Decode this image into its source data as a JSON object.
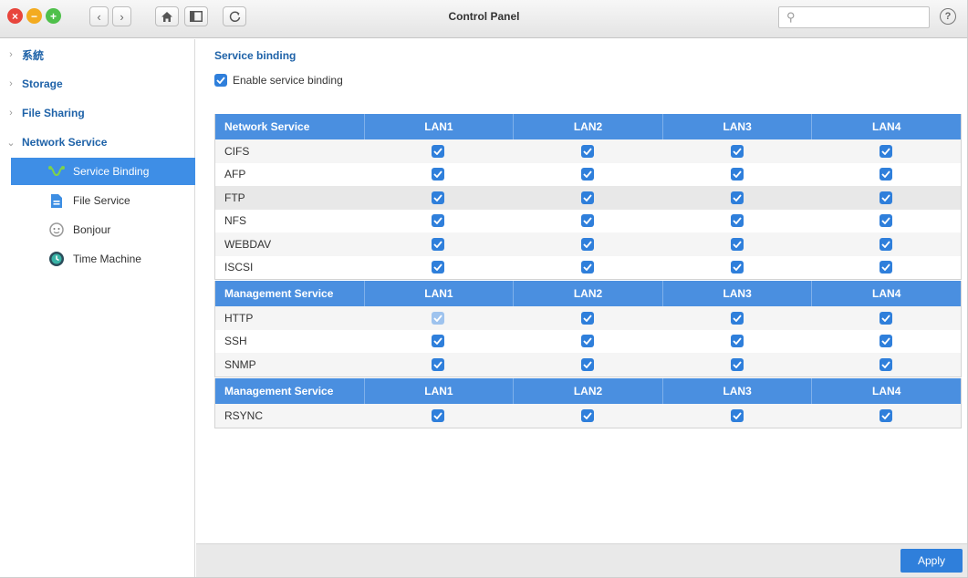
{
  "window": {
    "title": "Control Panel"
  },
  "titlebar": {
    "close_icon": "close-icon",
    "minimize_icon": "minimize-icon",
    "zoom_icon": "zoom-icon",
    "search_placeholder": "",
    "help_label": "?"
  },
  "sidebar": {
    "items": [
      {
        "label": "系統",
        "expanded": false
      },
      {
        "label": "Storage",
        "expanded": false
      },
      {
        "label": "File Sharing",
        "expanded": false
      },
      {
        "label": "Network Service",
        "expanded": true
      }
    ],
    "subitems": [
      {
        "label": "Service Binding",
        "icon": "service-binding-icon",
        "active": true
      },
      {
        "label": "File Service",
        "icon": "file-service-icon",
        "active": false
      },
      {
        "label": "Bonjour",
        "icon": "bonjour-icon",
        "active": false
      },
      {
        "label": "Time Machine",
        "icon": "time-machine-icon",
        "active": false
      }
    ]
  },
  "main": {
    "section_title": "Service binding",
    "enable_label": "Enable service binding",
    "enable_checked": true,
    "tables": [
      {
        "header": [
          "Network Service",
          "LAN1",
          "LAN2",
          "LAN3",
          "LAN4"
        ],
        "rows": [
          {
            "name": "CIFS",
            "checks": [
              true,
              true,
              true,
              true
            ]
          },
          {
            "name": "AFP",
            "checks": [
              true,
              true,
              true,
              true
            ]
          },
          {
            "name": "FTP",
            "checks": [
              true,
              true,
              true,
              true
            ],
            "highlighted": true
          },
          {
            "name": "NFS",
            "checks": [
              true,
              true,
              true,
              true
            ]
          },
          {
            "name": "WEBDAV",
            "checks": [
              true,
              true,
              true,
              true
            ]
          },
          {
            "name": "ISCSI",
            "checks": [
              true,
              true,
              true,
              true
            ]
          }
        ]
      },
      {
        "header": [
          "Management Service",
          "LAN1",
          "LAN2",
          "LAN3",
          "LAN4"
        ],
        "rows": [
          {
            "name": "HTTP",
            "checks": [
              true,
              true,
              true,
              true
            ],
            "disabled_first": true
          },
          {
            "name": "SSH",
            "checks": [
              true,
              true,
              true,
              true
            ]
          },
          {
            "name": "SNMP",
            "checks": [
              true,
              true,
              true,
              true
            ]
          }
        ]
      },
      {
        "header": [
          "Management Service",
          "LAN1",
          "LAN2",
          "LAN3",
          "LAN4"
        ],
        "rows": [
          {
            "name": "RSYNC",
            "checks": [
              true,
              true,
              true,
              true
            ]
          }
        ]
      }
    ]
  },
  "footer": {
    "apply_label": "Apply"
  },
  "colors": {
    "accent": "#2f7fdb",
    "header": "#4a8fe0",
    "link": "#1e62a8"
  }
}
